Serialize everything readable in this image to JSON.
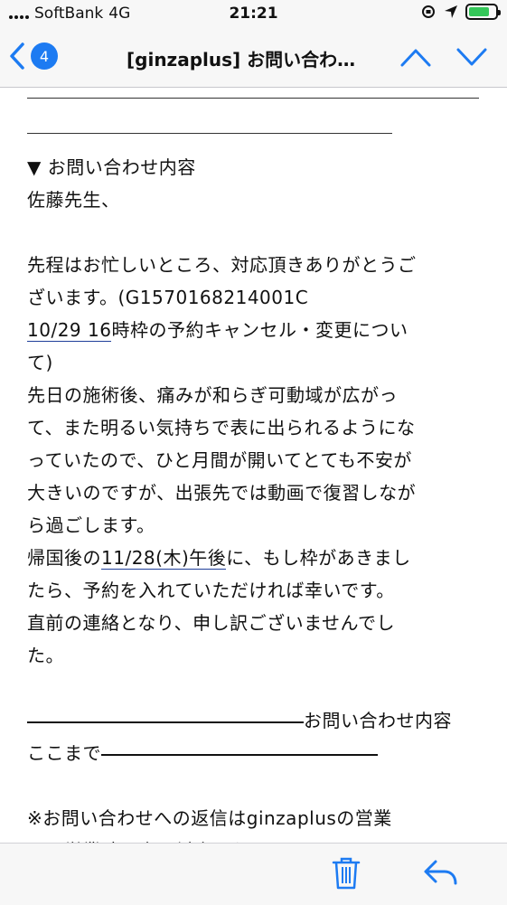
{
  "status_bar": {
    "carrier": "SoftBank",
    "network": "4G",
    "time": "21:21"
  },
  "nav": {
    "back_badge_count": "4",
    "title": "[ginzaplus] お問い合わ…",
    "back_icon": "chevron-left-icon",
    "up_icon": "chevron-up-icon",
    "down_icon": "chevron-down-icon",
    "accent_color": "#1d7bf2"
  },
  "message": {
    "section_heading": "▼ お問い合わせ内容",
    "salutation": "佐藤先生、",
    "para1": [
      "先程はお忙しいところ、対応頂きありがとうご",
      "ざいます。(G1570168214001C"
    ],
    "line_date_link": "10/29 16",
    "line_date_rest": "時枠の予約キャンセル・変更につい",
    "line_te": "て)",
    "para2": [
      "先日の施術後、痛みが和らぎ可動域が広がっ",
      "て、また明るい気持ちで表に出られるようにな",
      "っていたので、ひと月間が開いてとても不安が",
      "大きいのですが、出張先では動画で復習しなが",
      "ら過ごします。"
    ],
    "return_prefix": "帰国後の",
    "return_date_link": "11/28(木)",
    "return_after_link": "午後",
    "return_suffix": "に、もし枠があきまし",
    "para3": [
      "たら、予約を入れていただければ幸いです。",
      "直前の連絡となり、申し訳ございませんでし",
      "た。"
    ],
    "divider_end_text": "お問い合わせ内容",
    "divider_end_text2": "ここまで",
    "note_line1": "※お問い合わせへの返信はginzaplusの営業",
    "note_line2": "日・営業時間内の対応となります。"
  },
  "toolbar": {
    "trash_icon": "trash-icon",
    "reply_icon": "reply-icon"
  }
}
